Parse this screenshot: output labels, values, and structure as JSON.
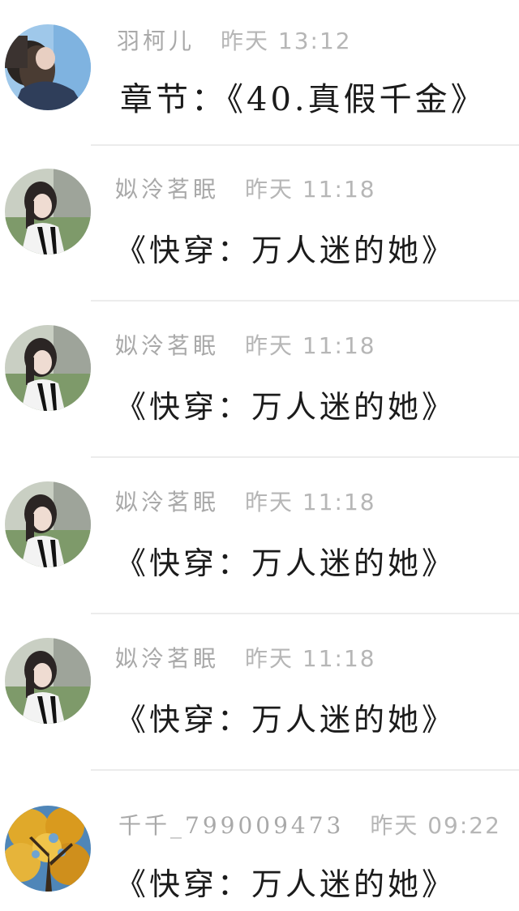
{
  "comments": [
    {
      "avatar": "avatar-girl-blue-background",
      "username": "羽柯儿",
      "time": "昨天 13:12",
      "content": "章节：《40.真假千金》"
    },
    {
      "avatar": "avatar-girl-school-uniform",
      "username": "姒泠茗眠",
      "time": "昨天 11:18",
      "content": "《快穿：万人迷的她》"
    },
    {
      "avatar": "avatar-girl-school-uniform",
      "username": "姒泠茗眠",
      "time": "昨天 11:18",
      "content": "《快穿：万人迷的她》"
    },
    {
      "avatar": "avatar-girl-school-uniform",
      "username": "姒泠茗眠",
      "time": "昨天 11:18",
      "content": "《快穿：万人迷的她》"
    },
    {
      "avatar": "avatar-girl-school-uniform",
      "username": "姒泠茗眠",
      "time": "昨天 11:18",
      "content": "《快穿：万人迷的她》"
    },
    {
      "avatar": "avatar-autumn-tree",
      "username": "千千_799009473",
      "time": "昨天 09:22",
      "content": "《快穿：万人迷的她》"
    }
  ]
}
